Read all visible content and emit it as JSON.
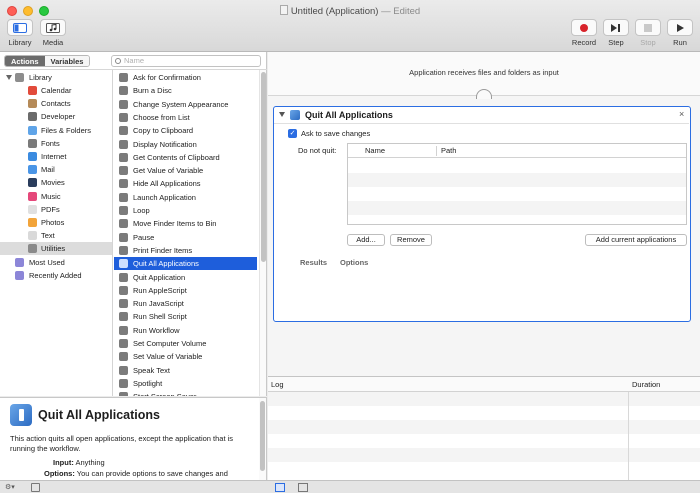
{
  "window": {
    "title": "Untitled (Application)",
    "edited_suffix": "— Edited"
  },
  "toolbar": {
    "library_label": "Library",
    "media_label": "Media",
    "record_label": "Record",
    "step_label": "Step",
    "stop_label": "Stop",
    "run_label": "Run"
  },
  "library": {
    "tab_actions": "Actions",
    "tab_variables": "Variables",
    "search_placeholder": "Name",
    "root": "Library",
    "categories": [
      {
        "label": "Calendar",
        "icon": "calendar-icon",
        "color": "#e24b3b"
      },
      {
        "label": "Contacts",
        "icon": "contacts-icon",
        "color": "#b58a58"
      },
      {
        "label": "Developer",
        "icon": "developer-icon",
        "color": "#6b6b6b"
      },
      {
        "label": "Files & Folders",
        "icon": "folder-icon",
        "color": "#5fa4e8"
      },
      {
        "label": "Fonts",
        "icon": "fonts-icon",
        "color": "#7a7a7a"
      },
      {
        "label": "Internet",
        "icon": "globe-icon",
        "color": "#3b8be0"
      },
      {
        "label": "Mail",
        "icon": "mail-icon",
        "color": "#4a95e6"
      },
      {
        "label": "Movies",
        "icon": "movies-icon",
        "color": "#2a3d5c"
      },
      {
        "label": "Music",
        "icon": "music-icon",
        "color": "#e5487a"
      },
      {
        "label": "PDFs",
        "icon": "pdf-icon",
        "color": "#e0e0e0"
      },
      {
        "label": "Photos",
        "icon": "photos-icon",
        "color": "#f2a43a"
      },
      {
        "label": "Text",
        "icon": "text-icon",
        "color": "#d9d9d9"
      },
      {
        "label": "Utilities",
        "icon": "utilities-icon",
        "color": "#8a8a8a"
      }
    ],
    "smart_groups": [
      {
        "label": "Most Used",
        "icon": "smart-folder-icon",
        "color": "#8c86d8"
      },
      {
        "label": "Recently Added",
        "icon": "smart-folder-icon",
        "color": "#8c86d8"
      }
    ],
    "actions": [
      "Ask for Confirmation",
      "Burn a Disc",
      "Change System Appearance",
      "Choose from List",
      "Copy to Clipboard",
      "Display Notification",
      "Get Contents of Clipboard",
      "Get Value of Variable",
      "Hide All Applications",
      "Launch Application",
      "Loop",
      "Move Finder Items to Bin",
      "Pause",
      "Print Finder Items",
      "Quit All Applications",
      "Quit Application",
      "Run AppleScript",
      "Run JavaScript",
      "Run Shell Script",
      "Run Workflow",
      "Set Computer Volume",
      "Set Value of Variable",
      "Speak Text",
      "Spotlight",
      "Start Screen Saver"
    ],
    "selected_action": "Quit All Applications",
    "selected_category": "Utilities"
  },
  "description": {
    "title": "Quit All Applications",
    "body": "This action quits all open applications, except the application that is running the workflow.",
    "input_key": "Input:",
    "input_value": "Anything",
    "options_key": "Options:",
    "options_value": "You can provide options to save changes and"
  },
  "workflow": {
    "header": "Application receives files and folders as input",
    "action": {
      "title": "Quit All Applications",
      "close": "×",
      "ask_to_save_label": "Ask to save changes",
      "ask_to_save_checked": true,
      "do_not_quit_label": "Do not quit:",
      "columns": [
        "Name",
        "Path"
      ],
      "add_button": "Add...",
      "remove_button": "Remove",
      "add_current_button": "Add current applications",
      "tab_results": "Results",
      "tab_options": "Options"
    }
  },
  "log": {
    "col_log": "Log",
    "col_duration": "Duration"
  },
  "colors": {
    "accent": "#2b6de2",
    "selection": "#1e5edb"
  }
}
